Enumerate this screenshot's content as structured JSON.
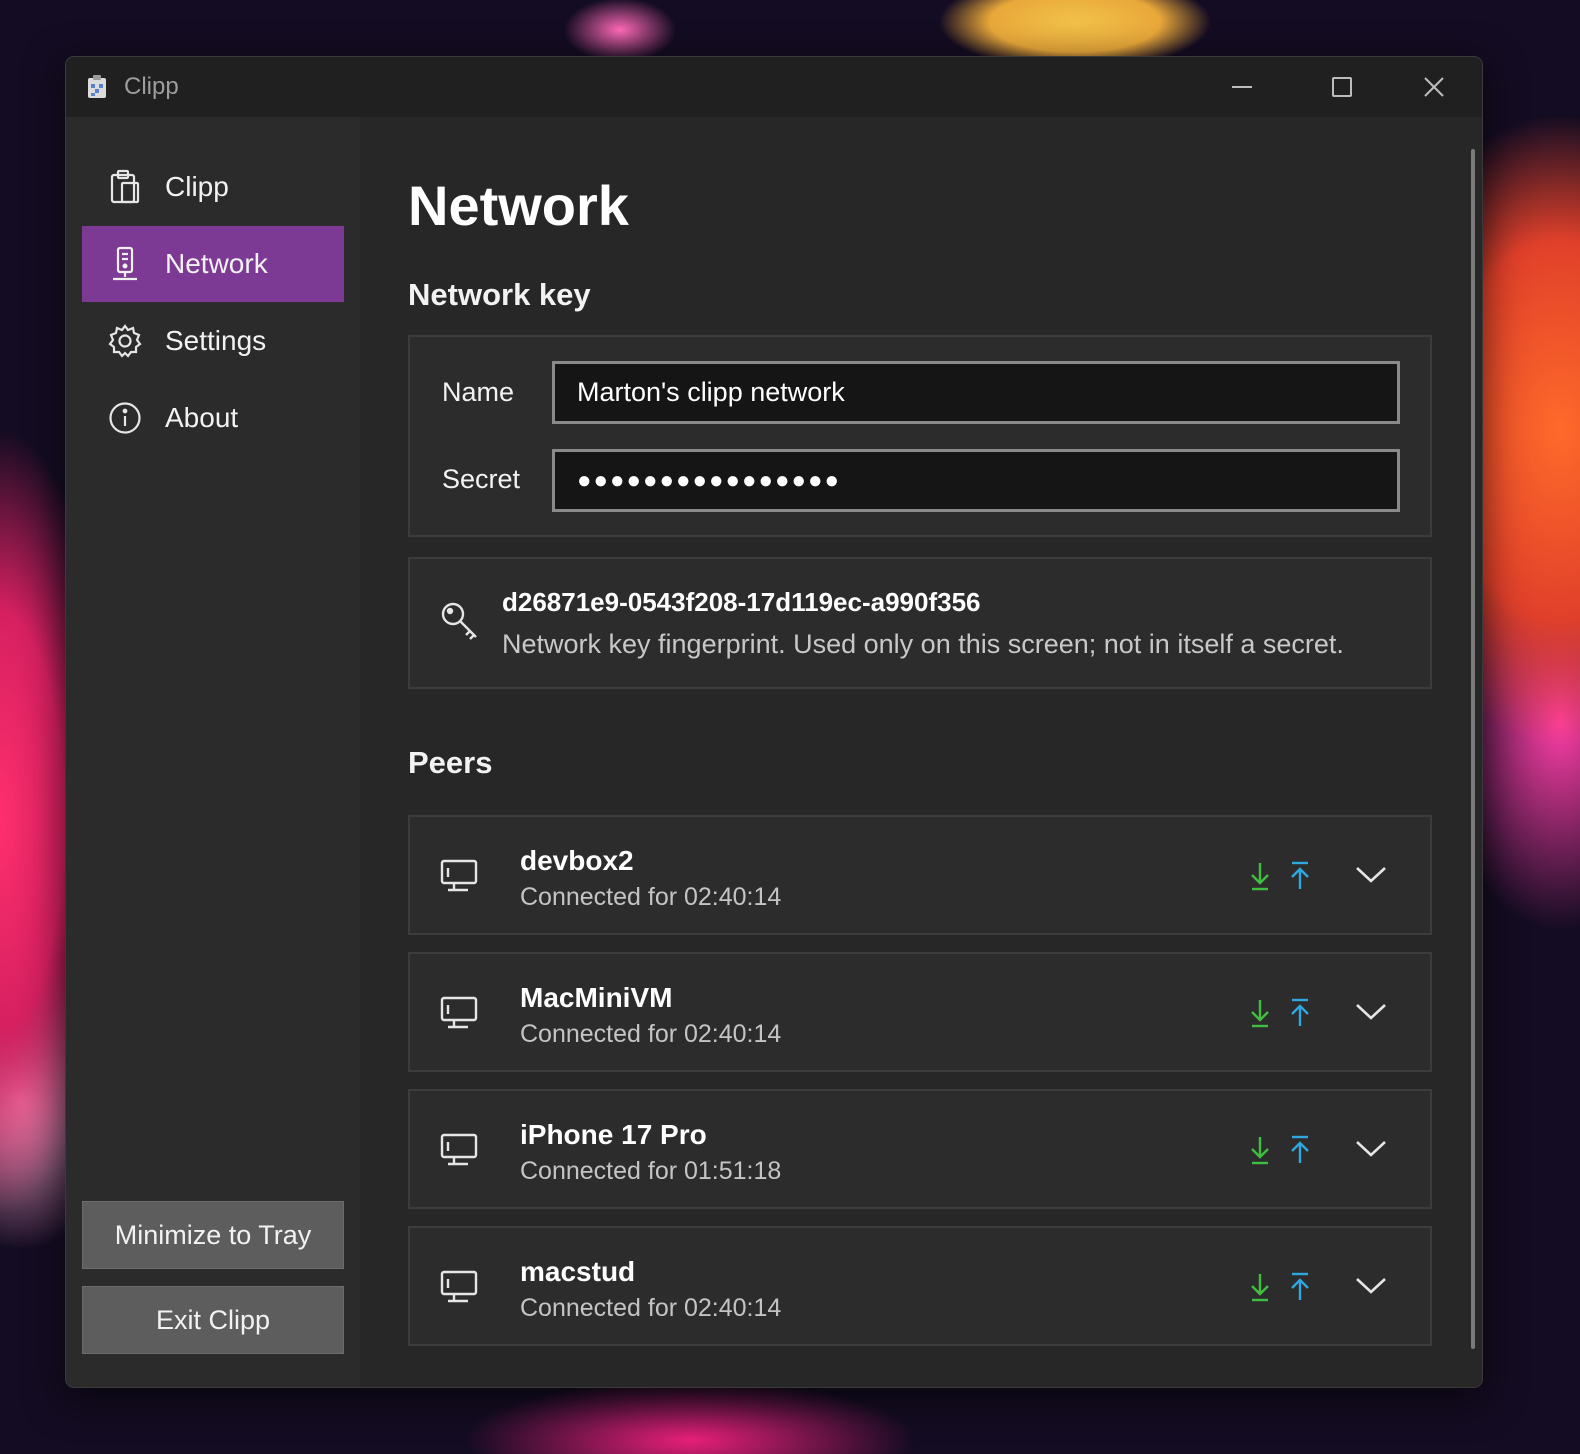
{
  "window": {
    "title": "Clipp",
    "controls": [
      "minimize-icon",
      "maximize-icon",
      "close-icon"
    ]
  },
  "sidebar": {
    "items": [
      {
        "label": "Clipp",
        "icon": "clipboard-icon",
        "active": false
      },
      {
        "label": "Network",
        "icon": "network-server-icon",
        "active": true
      },
      {
        "label": "Settings",
        "icon": "gear-icon",
        "active": false
      },
      {
        "label": "About",
        "icon": "info-icon",
        "active": false
      }
    ],
    "minimize_label": "Minimize to Tray",
    "exit_label": "Exit Clipp"
  },
  "page": {
    "title": "Network",
    "network_key": {
      "heading": "Network key",
      "name_label": "Name",
      "name_value": "Marton's clipp network",
      "secret_label": "Secret",
      "secret_value": "●●●●●●●●●●●●●●●●"
    },
    "fingerprint": {
      "value": "d26871e9-0543f208-17d119ec-a990f356",
      "description": "Network key fingerprint. Used only on this screen; not in itself a secret."
    },
    "peers_heading": "Peers",
    "peers": [
      {
        "name": "devbox2",
        "status": "Connected for 02:40:14"
      },
      {
        "name": "MacMiniVM",
        "status": "Connected for 02:40:14"
      },
      {
        "name": "iPhone 17 Pro",
        "status": "Connected for 01:51:18"
      },
      {
        "name": "macstud",
        "status": "Connected for 02:40:14"
      }
    ]
  },
  "colors": {
    "accent": "#7d3a94",
    "download": "#3fbf3f",
    "upload": "#2fa8e0",
    "window_bg": "#202020",
    "content_bg": "#272727"
  }
}
